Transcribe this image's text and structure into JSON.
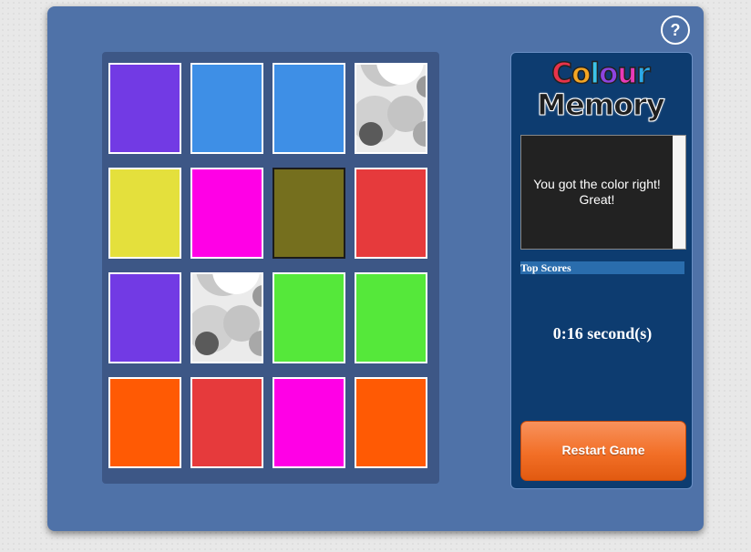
{
  "help": {
    "label": "?"
  },
  "board": {
    "colors": {
      "purple": "#723ae4",
      "blue": "#3e8fe6",
      "yellow": "#e4e03c",
      "magenta": "#ff00e6",
      "olive": "#756f1e",
      "red": "#e63a3c",
      "green": "#55e83a",
      "orange": "#ff5a04"
    },
    "cards": [
      {
        "state": "face-up",
        "color": "purple"
      },
      {
        "state": "face-up",
        "color": "blue"
      },
      {
        "state": "face-up",
        "color": "blue"
      },
      {
        "state": "face-down",
        "color": ""
      },
      {
        "state": "face-up",
        "color": "yellow"
      },
      {
        "state": "face-up",
        "color": "magenta"
      },
      {
        "state": "face-up",
        "color": "olive",
        "selected": true
      },
      {
        "state": "face-up",
        "color": "red"
      },
      {
        "state": "face-up",
        "color": "purple"
      },
      {
        "state": "face-down",
        "color": ""
      },
      {
        "state": "face-up",
        "color": "green"
      },
      {
        "state": "face-up",
        "color": "green"
      },
      {
        "state": "face-up",
        "color": "orange"
      },
      {
        "state": "face-up",
        "color": "red"
      },
      {
        "state": "face-up",
        "color": "magenta"
      },
      {
        "state": "face-up",
        "color": "orange"
      }
    ]
  },
  "panel": {
    "logo": {
      "line1_letters": [
        {
          "ch": "C",
          "color": "#e8334a"
        },
        {
          "ch": "o",
          "color": "#f5a623"
        },
        {
          "ch": "l",
          "color": "#3cc4e8"
        },
        {
          "ch": "o",
          "color": "#8e44e0"
        },
        {
          "ch": "u",
          "color": "#e83ab8"
        },
        {
          "ch": "r",
          "color": "#2ba9e8"
        }
      ],
      "line2": "Memory"
    },
    "message": "You got the color right! Great!",
    "top_scores_label": "Top Scores",
    "timer": "0:16 second(s)",
    "restart_label": "Restart Game"
  }
}
